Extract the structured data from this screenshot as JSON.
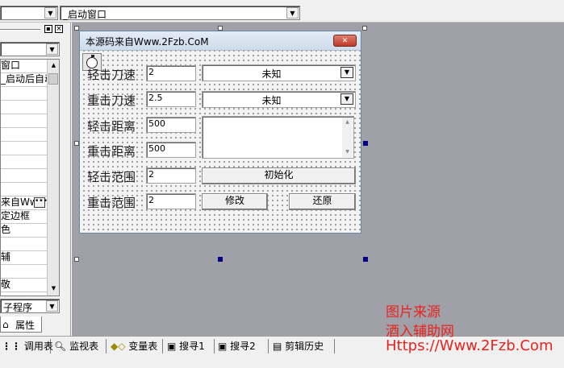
{
  "toolbar": {
    "object_combo_value": "",
    "event_combo_value": "_启动窗口"
  },
  "properties_panel": {
    "rows": [
      "窗口",
      "_启动后自动",
      "",
      "",
      "",
      "",
      "",
      "",
      "",
      "",
      "来自Www",
      "定边框",
      "色",
      "",
      "辅",
      "",
      "敬"
    ],
    "selected_object_value": "来自Www",
    "bottom_combo_value": "子程序",
    "tab_label": "属性"
  },
  "form_window": {
    "title": "本源码来自Www.2Fzb.CoM",
    "close_glyph": "✕",
    "timer_icon": "stopwatch-icon",
    "labels": {
      "light_speed": "轻击刀速",
      "heavy_speed": "重击刀速",
      "light_dist": "轻击距离",
      "heavy_dist": "重击距离",
      "light_range": "轻击范围",
      "heavy_range": "重击范围"
    },
    "values": {
      "light_speed": "2",
      "heavy_speed": "2.5",
      "light_dist": "500",
      "heavy_dist": "500",
      "light_range": "2",
      "heavy_range": "2"
    },
    "combos": {
      "light_speed_state": "未知",
      "heavy_speed_state": "未知"
    },
    "buttons": {
      "init": "初始化",
      "modify": "修改",
      "restore": "还原"
    }
  },
  "bottom_tabs": [
    {
      "icon": "grid-icon",
      "label": "调用表"
    },
    {
      "icon": "magnifier-icon",
      "label": "监视表"
    },
    {
      "icon": "variables-icon",
      "label": "变量表"
    },
    {
      "icon": "search-window-icon",
      "label": "搜寻1"
    },
    {
      "icon": "search-window-icon",
      "label": "搜寻2"
    },
    {
      "icon": "clipboard-icon",
      "label": "剪辑历史"
    }
  ],
  "watermark": {
    "line1": "图片来源",
    "line2": "酒入辅助网",
    "line3": "Https://Www.2Fzb.Com"
  },
  "colors": {
    "mdi_background": "#a0a0a8",
    "title_bar": "#d6e3f2",
    "close_button": "#c83a2a",
    "selection_handle": "#000080",
    "watermark": "#e8231d"
  }
}
